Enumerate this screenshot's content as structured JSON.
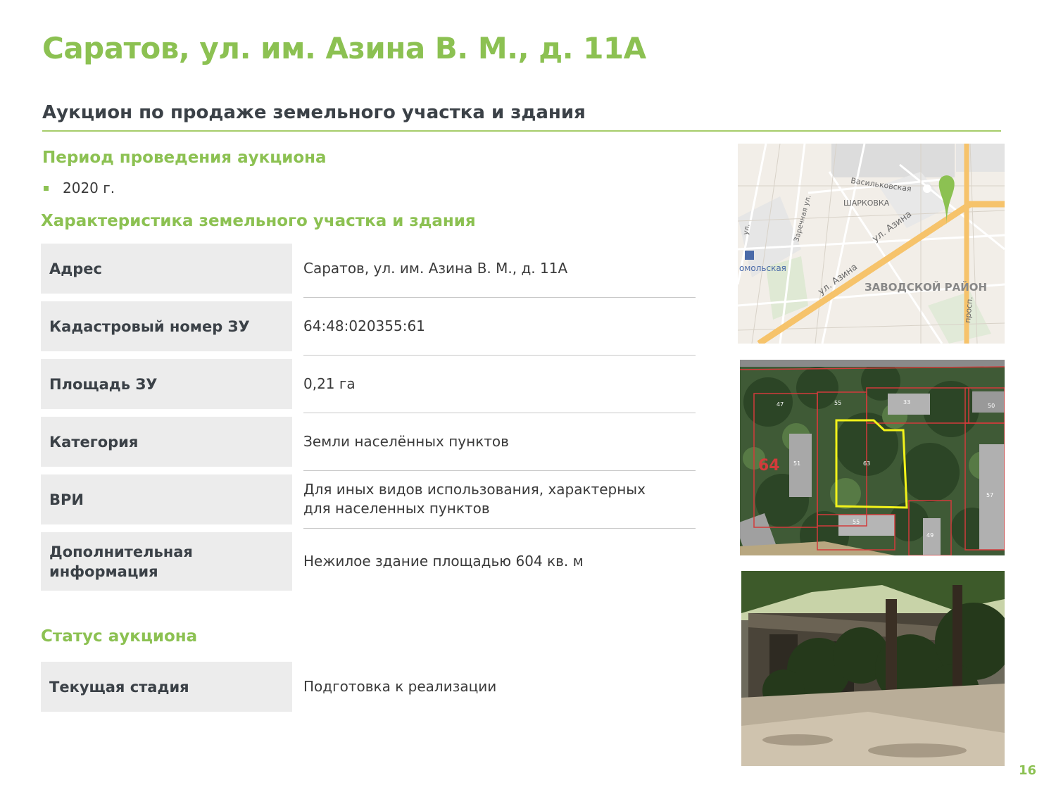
{
  "title": "Саратов, ул. им. Азина В. М., д. 11А",
  "subtitle": "Аукцион по продаже земельного участка и здания",
  "period": {
    "heading": "Период проведения аукциона",
    "items": [
      "2020 г."
    ]
  },
  "characteristics": {
    "heading": "Характеристика земельного участка и здания",
    "rows": [
      {
        "label": "Адрес",
        "value": "Саратов, ул. им. Азина В. М., д. 11А"
      },
      {
        "label": "Кадастровый номер ЗУ",
        "value": "64:48:020355:61"
      },
      {
        "label": "Площадь ЗУ",
        "value": "0,21 га"
      },
      {
        "label": "Категория",
        "value": "Земли населённых пунктов"
      },
      {
        "label": "ВРИ",
        "value": "Для иных видов использования, характерных для населенных пунктов"
      },
      {
        "label": "Дополнительная информация",
        "value": "Нежилое здание площадью 604 кв. м"
      }
    ]
  },
  "status": {
    "heading": "Статус аукциона",
    "rows": [
      {
        "label": "Текущая стадия",
        "value": "Подготовка к реализации"
      }
    ]
  },
  "map": {
    "labels": [
      "Васильковская",
      "ШАРКОВКА",
      "Заречная ул.",
      "ул. Азина",
      "ул. Азина",
      "ЗАВОДСКОЙ РАЙОН",
      "омольская",
      "просп.",
      "ул."
    ]
  },
  "cadastral_plan": {
    "labels": [
      "64",
      "63",
      "33",
      "55",
      "47",
      "57",
      "55",
      "49",
      "51",
      "50"
    ]
  },
  "page_number": "16",
  "colors": {
    "accent": "#8cc152",
    "heading": "#3b4147",
    "label_bg": "#ececec"
  }
}
